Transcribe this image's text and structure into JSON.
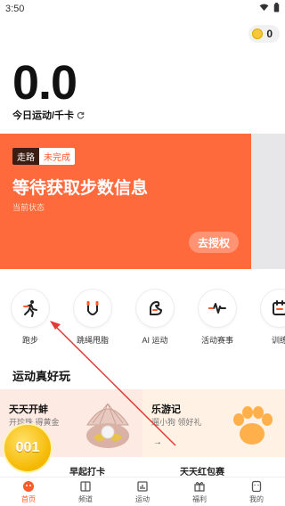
{
  "status_bar": {
    "time": "3:50"
  },
  "coins": {
    "value": "0"
  },
  "summary": {
    "value": "0.0",
    "label": "今日运动/千卡"
  },
  "hero": {
    "tag_walk": "走路",
    "tag_status": "未完成",
    "title": "等待获取步数信息",
    "subtitle": "当前状态",
    "auth_button": "去授权"
  },
  "shortcuts": [
    {
      "label": "跑步"
    },
    {
      "label": "跳绳甩脂"
    },
    {
      "label": "AI 运动"
    },
    {
      "label": "活动赛事"
    },
    {
      "label": "训练"
    }
  ],
  "section": {
    "title": "运动真好玩"
  },
  "cards": {
    "left": {
      "title": "天天开蚌",
      "subtitle": "开珍珠 得黄金"
    },
    "right": {
      "title": "乐游记",
      "subtitle": "遛小狗 领好礼"
    }
  },
  "bottom_row": [
    "早起打卡",
    "天天红包赛"
  ],
  "float_coin": {
    "text": "001"
  },
  "tabs": [
    {
      "label": "首页"
    },
    {
      "label": "频道"
    },
    {
      "label": "运动"
    },
    {
      "label": "福利"
    },
    {
      "label": "我的"
    }
  ],
  "colors": {
    "accent": "#ff6a3d",
    "hero_bg": "#ff6a3d",
    "annotation_arrow": "#e53935"
  }
}
